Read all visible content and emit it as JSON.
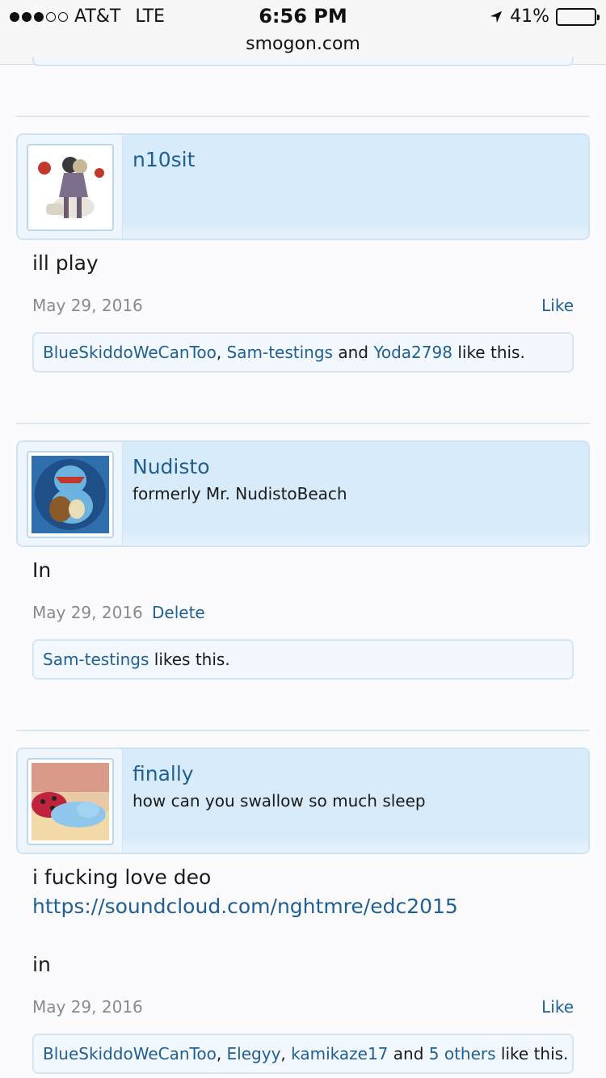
{
  "status_bar": {
    "carrier": "AT&T",
    "network": "LTE",
    "time": "6:56 PM",
    "battery": "41%",
    "battery_level": 0.41,
    "url": "smogon.com"
  },
  "posts": [
    {
      "username": "n10sit",
      "user_title": "",
      "message_lines": [
        "ill play"
      ],
      "date": "May 29, 2016",
      "action": "Like",
      "likes": {
        "names": [
          "BlueSkiddoWeCanToo",
          "Sam-testings",
          "Yoda2798"
        ],
        "suffix": "like this.",
        "joiner": "and",
        "others": ""
      }
    },
    {
      "username": "Nudisto",
      "user_title": "formerly Mr. NudistoBeach",
      "message_lines": [
        "In"
      ],
      "date": "May 29, 2016",
      "action": "Delete",
      "likes": {
        "names": [
          "Sam-testings"
        ],
        "suffix": "likes this.",
        "joiner": "",
        "others": ""
      }
    },
    {
      "username": "finally",
      "user_title": "how can you swallow so much sleep",
      "message_lines": [
        "i fucking love deo"
      ],
      "message_link": "https://soundcloud.com/nghtmre/edc2015",
      "message_after": "in",
      "date": "May 29, 2016",
      "action": "Like",
      "likes": {
        "names": [
          "BlueSkiddoWeCanToo",
          "Elegyy",
          "kamikaze17"
        ],
        "suffix": "like this.",
        "joiner": "and",
        "others": "5 others"
      }
    }
  ],
  "icons": {
    "signal": "signal-dots-icon",
    "location": "location-arrow-icon",
    "battery": "battery-icon"
  },
  "colors": {
    "link": "#1f5f92",
    "userbox_bg": "#d8ebfa",
    "meta": "#8a8a8a"
  }
}
